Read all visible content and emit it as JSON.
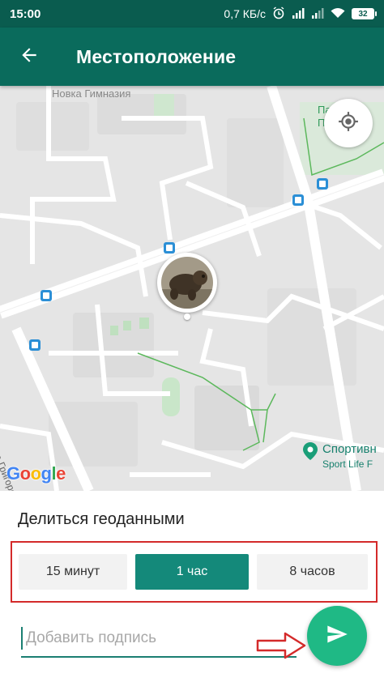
{
  "status_bar": {
    "time": "15:00",
    "network_speed": "0,7 КБ/с",
    "battery_level": "32",
    "icons": [
      "alarm-icon",
      "signal-icon",
      "signal-icon",
      "wifi-icon",
      "battery-icon"
    ]
  },
  "app_bar": {
    "title": "Местоположение",
    "back_icon": "arrow-left-icon"
  },
  "map": {
    "labels": {
      "top": "Новка Гимназия",
      "park": "Парк Победы",
      "street": "ул. Петра Григоренко"
    },
    "poi": {
      "name": "Спортивн",
      "subtitle": "Sport Life F"
    },
    "google_logo": [
      "G",
      "o",
      "o",
      "g",
      "l",
      "e"
    ],
    "google_colors": [
      "#4285f4",
      "#ea4335",
      "#fbbc05",
      "#4285f4",
      "#34a853",
      "#ea4335"
    ],
    "locate_icon": "crosshair-icon",
    "transit_icon": "tram-stop-icon"
  },
  "share": {
    "title": "Делиться геоданными",
    "options": [
      {
        "label": "15 минут",
        "selected": false
      },
      {
        "label": "1 час",
        "selected": true
      },
      {
        "label": "8 часов",
        "selected": false
      }
    ]
  },
  "caption": {
    "placeholder": "Добавить подпись",
    "value": ""
  },
  "send_icon": "send-icon",
  "colors": {
    "status_bar": "#0a5c4f",
    "app_bar": "#0a6b5c",
    "accent": "#14897a",
    "send_button": "#1fb985",
    "annotation": "#d42a2a"
  }
}
